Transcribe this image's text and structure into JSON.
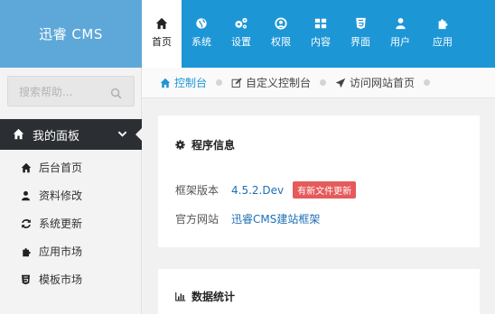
{
  "logo": {
    "text": "迅睿 CMS"
  },
  "topnav": {
    "items": [
      {
        "label": "首页",
        "icon": "home-icon"
      },
      {
        "label": "系统",
        "icon": "globe-icon"
      },
      {
        "label": "设置",
        "icon": "cogs-icon"
      },
      {
        "label": "权限",
        "icon": "user-circle-icon"
      },
      {
        "label": "内容",
        "icon": "grid-icon"
      },
      {
        "label": "界面",
        "icon": "html5-icon"
      },
      {
        "label": "用户",
        "icon": "user-icon"
      },
      {
        "label": "应用",
        "icon": "puzzle-icon"
      }
    ],
    "active_index": 0
  },
  "sidebar": {
    "search_placeholder": "搜索帮助...",
    "panel_title": "我的面板",
    "items": [
      {
        "label": "后台首页",
        "icon": "home-icon"
      },
      {
        "label": "资料修改",
        "icon": "user-icon"
      },
      {
        "label": "系统更新",
        "icon": "refresh-icon"
      },
      {
        "label": "应用市场",
        "icon": "puzzle-icon"
      },
      {
        "label": "模板市场",
        "icon": "html5-icon"
      }
    ]
  },
  "breadcrumb": {
    "items": [
      {
        "label": "控制台",
        "icon": "home-icon"
      },
      {
        "label": "自定义控制台",
        "icon": "edit-icon"
      },
      {
        "label": "访问网站首页",
        "icon": "send-icon"
      }
    ]
  },
  "program_info": {
    "title": "程序信息",
    "version_label": "框架版本",
    "version_value": "4.5.2.Dev",
    "update_badge": "有新文件更新",
    "site_label": "官方网站",
    "site_link": "迅睿CMS建站框架"
  },
  "stats": {
    "title": "数据统计"
  },
  "colors": {
    "topnav_bg": "#1d96d6",
    "logo_bg": "#5ea8d9",
    "badge": "#e55a5a",
    "panel_head": "#2b2e33"
  }
}
